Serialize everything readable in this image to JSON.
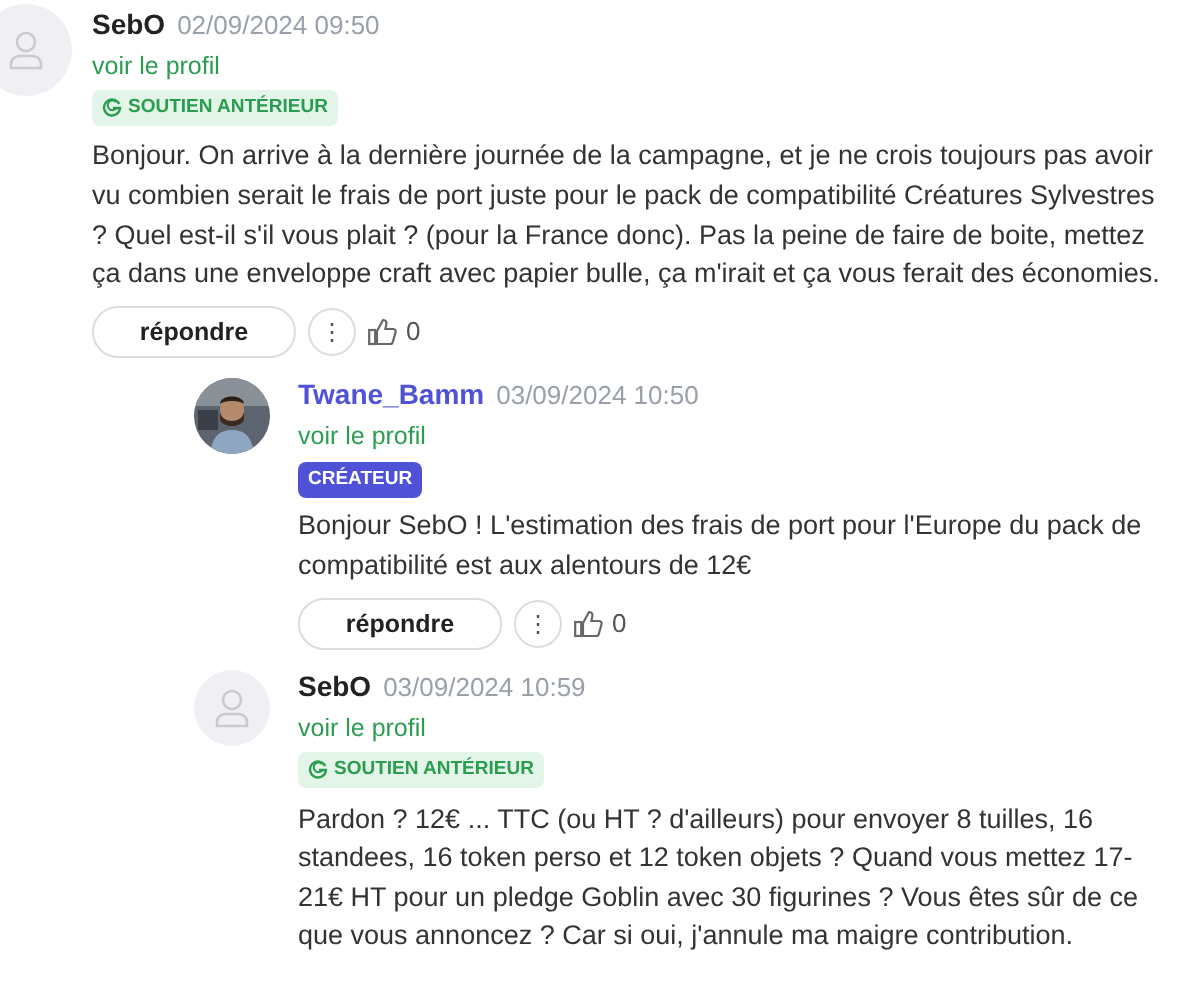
{
  "comments": [
    {
      "author": "SebO",
      "date": "02/09/2024 09:50",
      "profile_link": "voir le profil",
      "avatar": {
        "kind": "placeholder"
      },
      "badge": {
        "kind": "supporter",
        "label": "SOUTIEN ANTÉRIEUR"
      },
      "text": "Bonjour. On arrive à la dernière journée de la campagne, et je ne crois toujours pas avoir vu combien serait le frais de port juste pour le pack de compatibilité Créatures Sylvestres ? Quel est-il s'il vous plait ? (pour la France donc). Pas la peine de faire de boite, mettez ça dans une enveloppe craft avec papier bulle, ça m'irait et ça vous ferait des économies.",
      "actions": {
        "reply": "répondre",
        "more": "⋮",
        "likes": "0"
      },
      "children": [
        {
          "author": "Twane_Bamm",
          "date": "03/09/2024 10:50",
          "profile_link": "voir le profil",
          "badge": {
            "kind": "creator",
            "label": "CRÉATEUR"
          },
          "text": "Bonjour SebO ! L'estimation des frais de port pour l'Europe du pack de compatibilité est aux alentours de 12€",
          "actions": {
            "reply": "répondre",
            "more": "⋮",
            "likes": "0"
          }
        },
        {
          "author": "SebO",
          "date": "03/09/2024 10:59",
          "profile_link": "voir le profil",
          "avatar": {
            "kind": "placeholder"
          },
          "badge": {
            "kind": "supporter",
            "label": "SOUTIEN ANTÉRIEUR"
          },
          "text": "Pardon ? 12€ ... TTC (ou HT ? d'ailleurs) pour envoyer 8 tuilles, 16 standees, 16 token perso et 12 token objets ? Quand vous mettez 17-21€ HT pour un pledge Goblin avec 30 figurines ? Vous êtes sûr de ce que vous annoncez ? Car si oui, j'annule ma maigre contribution."
        }
      ]
    }
  ]
}
